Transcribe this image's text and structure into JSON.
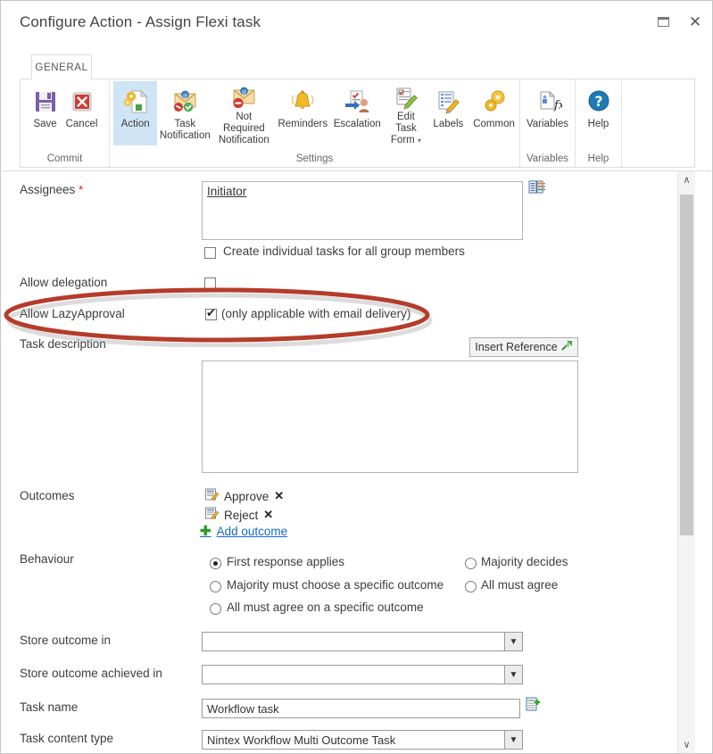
{
  "window": {
    "title": "Configure Action - Assign Flexi task",
    "restore_label": "Restore",
    "close_label": "Close"
  },
  "ribbon": {
    "tab": "GENERAL",
    "groups": [
      {
        "label": "Commit",
        "buttons": [
          {
            "label": "Save",
            "icon": "save-icon",
            "active": false
          },
          {
            "label": "Cancel",
            "icon": "cancel-icon",
            "active": false
          }
        ]
      },
      {
        "label": "Settings",
        "buttons": [
          {
            "label": "Action",
            "icon": "action-icon",
            "active": true
          },
          {
            "label": "Task Notification",
            "icon": "task-notification-icon",
            "active": false
          },
          {
            "label": "Not Required Notification",
            "icon": "not-required-notification-icon",
            "active": false
          },
          {
            "label": "Reminders",
            "icon": "reminders-bell-icon",
            "active": false
          },
          {
            "label": "Escalation",
            "icon": "escalation-icon",
            "active": false
          },
          {
            "label": "Edit Task Form",
            "icon": "edit-task-form-icon",
            "active": false,
            "dropdown": true
          },
          {
            "label": "Labels",
            "icon": "labels-icon",
            "active": false
          },
          {
            "label": "Common",
            "icon": "common-gears-icon",
            "active": false
          }
        ]
      },
      {
        "label": "Variables",
        "buttons": [
          {
            "label": "Variables",
            "icon": "variables-fx-icon",
            "active": false
          }
        ]
      },
      {
        "label": "Help",
        "buttons": [
          {
            "label": "Help",
            "icon": "help-question-icon",
            "active": false
          }
        ]
      }
    ]
  },
  "form": {
    "assignees": {
      "label": "Assignees",
      "required_marker": "*",
      "value": "Initiator",
      "picker_icon": "people-picker-icon"
    },
    "create_individual": {
      "label": "Create individual tasks for all group members",
      "checked": false
    },
    "allow_delegation": {
      "label": "Allow delegation",
      "checked": false
    },
    "allow_lazy_approval": {
      "label": "Allow LazyApproval",
      "note": "(only applicable with email delivery)",
      "checked": true
    },
    "task_description": {
      "label": "Task description",
      "value": "",
      "insert_reference_label": "Insert Reference",
      "insert_reference_icon": "insert-reference-icon"
    },
    "outcomes": {
      "label": "Outcomes",
      "items": [
        {
          "name": "Approve",
          "icon": "outcome-icon",
          "remove": "✕"
        },
        {
          "name": "Reject",
          "icon": "outcome-icon",
          "remove": "✕"
        }
      ],
      "add_label": "Add outcome",
      "add_icon": "plus-icon"
    },
    "behaviour": {
      "label": "Behaviour",
      "options": [
        {
          "label": "First response applies",
          "selected": true,
          "col": 1,
          "row": 1
        },
        {
          "label": "Majority decides",
          "selected": false,
          "col": 2,
          "row": 1
        },
        {
          "label": "Majority must choose a specific outcome",
          "selected": false,
          "col": 1,
          "row": 2
        },
        {
          "label": "All must agree",
          "selected": false,
          "col": 2,
          "row": 2
        },
        {
          "label": "All must agree on a specific outcome",
          "selected": false,
          "col": 1,
          "row": 3
        }
      ]
    },
    "store_outcome_in": {
      "label": "Store outcome in",
      "value": ""
    },
    "store_outcome_achieved_in": {
      "label": "Store outcome achieved in",
      "value": ""
    },
    "task_name": {
      "label": "Task name",
      "value": "Workflow task",
      "icon": "insert-lookup-icon"
    },
    "task_content_type": {
      "label": "Task content type",
      "value": "Nintex Workflow Multi Outcome Task"
    }
  },
  "scrollbar": {
    "up_arrow": "∧",
    "down_arrow": "∨"
  },
  "annotation": {
    "shape": "ellipse",
    "color": "#b53c2a",
    "targets": "Allow LazyApproval row"
  }
}
